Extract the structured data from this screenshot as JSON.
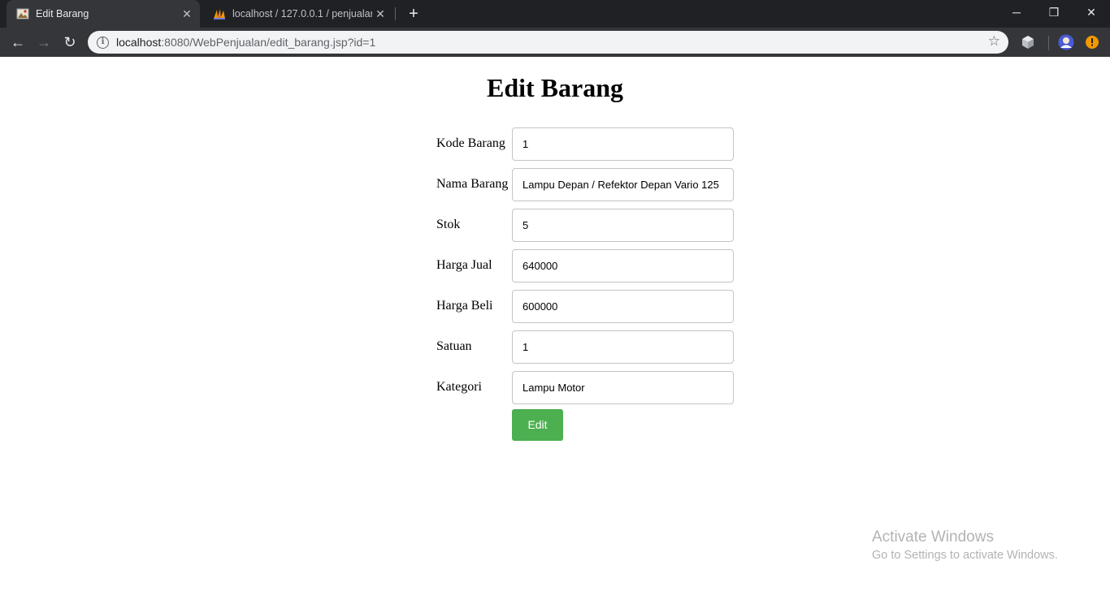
{
  "browser": {
    "tabs": [
      {
        "title": "Edit Barang",
        "active": true,
        "icon": "page-favicon"
      },
      {
        "title": "localhost / 127.0.0.1 / penjualan_",
        "active": false,
        "icon": "phpmyadmin-favicon"
      }
    ],
    "tab_close_glyph": "✕",
    "new_tab_glyph": "+",
    "window_controls": {
      "minimize": "─",
      "maximize": "❐",
      "close": "✕"
    },
    "nav": {
      "back": "←",
      "forward": "→",
      "reload": "↻"
    },
    "address_bar": {
      "host": "localhost",
      "rest": ":8080/WebPenjualan/edit_barang.jsp?id=1",
      "info_glyph": "i",
      "star_glyph": "☆"
    },
    "extensions": [
      "cube-extension-icon",
      "profile-avatar",
      "update-alert-icon"
    ],
    "colors": {
      "tabstrip": "#202124",
      "toolbar": "#35363a",
      "omnibox": "#f1f3f4",
      "alert": "#f29900"
    }
  },
  "page": {
    "title": "Edit Barang",
    "fields": [
      {
        "label": "Kode Barang",
        "value": "1"
      },
      {
        "label": "Nama Barang",
        "value": "Lampu Depan / Refektor Depan Vario 125"
      },
      {
        "label": "Stok",
        "value": "5"
      },
      {
        "label": "Harga Jual",
        "value": "640000"
      },
      {
        "label": "Harga Beli",
        "value": "600000"
      },
      {
        "label": "Satuan",
        "value": "1"
      },
      {
        "label": "Kategori",
        "value": "Lampu Motor"
      }
    ],
    "submit_label": "Edit",
    "submit_color": "#4caf50"
  },
  "watermark": {
    "line1": "Activate Windows",
    "line2": "Go to Settings to activate Windows."
  }
}
